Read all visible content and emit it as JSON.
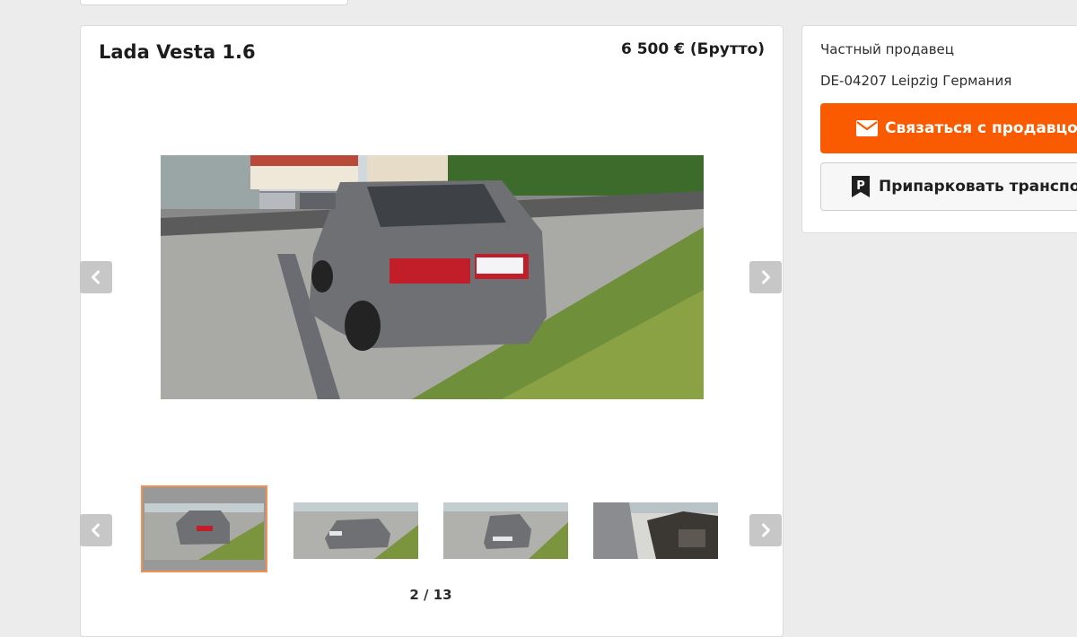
{
  "listing": {
    "title": "Lada Vesta 1.6",
    "price": "6 500 € (Брутто)"
  },
  "gallery": {
    "counter": "2 / 13",
    "current_index": 2,
    "total": 13,
    "thumbnail_count_visible": 4,
    "selected_thumbnail": 1,
    "prev_icon": "chevron-left-icon",
    "next_icon": "chevron-right-icon"
  },
  "seller": {
    "type": "Частный продавец",
    "location": "DE-04207 Leipzig Германия",
    "contact_label": "Связаться с продавцом",
    "contact_icon": "envelope-icon",
    "park_label": "Припарковать транспортное средство",
    "park_icon": "parking-icon"
  },
  "colors": {
    "accent": "#fb5b00",
    "selected_outline": "#f29152",
    "page_background": "#ececed"
  }
}
